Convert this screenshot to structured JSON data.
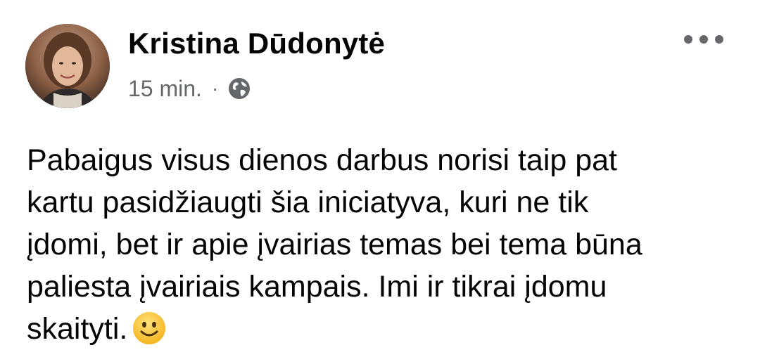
{
  "post": {
    "author_name": "Kristina Dūdonytė",
    "timestamp": "15 min.",
    "separator": "·",
    "privacy_icon": "globe-icon",
    "more_icon": "more-horizontal-icon",
    "message_lines": [
      "Pabaigus visus dienos darbus norisi taip pat",
      "kartu pasidžiaugti šia iniciatyva, kuri ne tik",
      "įdomi, bet ir apie įvairias temas bei tema būna",
      "paliesta įvairiais kampais. Imi ir tikrai įdomu",
      "skaityti."
    ],
    "message_emoji": "slightly-smiling-face-emoji"
  },
  "colors": {
    "text_primary": "#050505",
    "text_secondary": "#65676b",
    "background": "#ffffff",
    "emoji_yellow": "#ffcc4d"
  }
}
